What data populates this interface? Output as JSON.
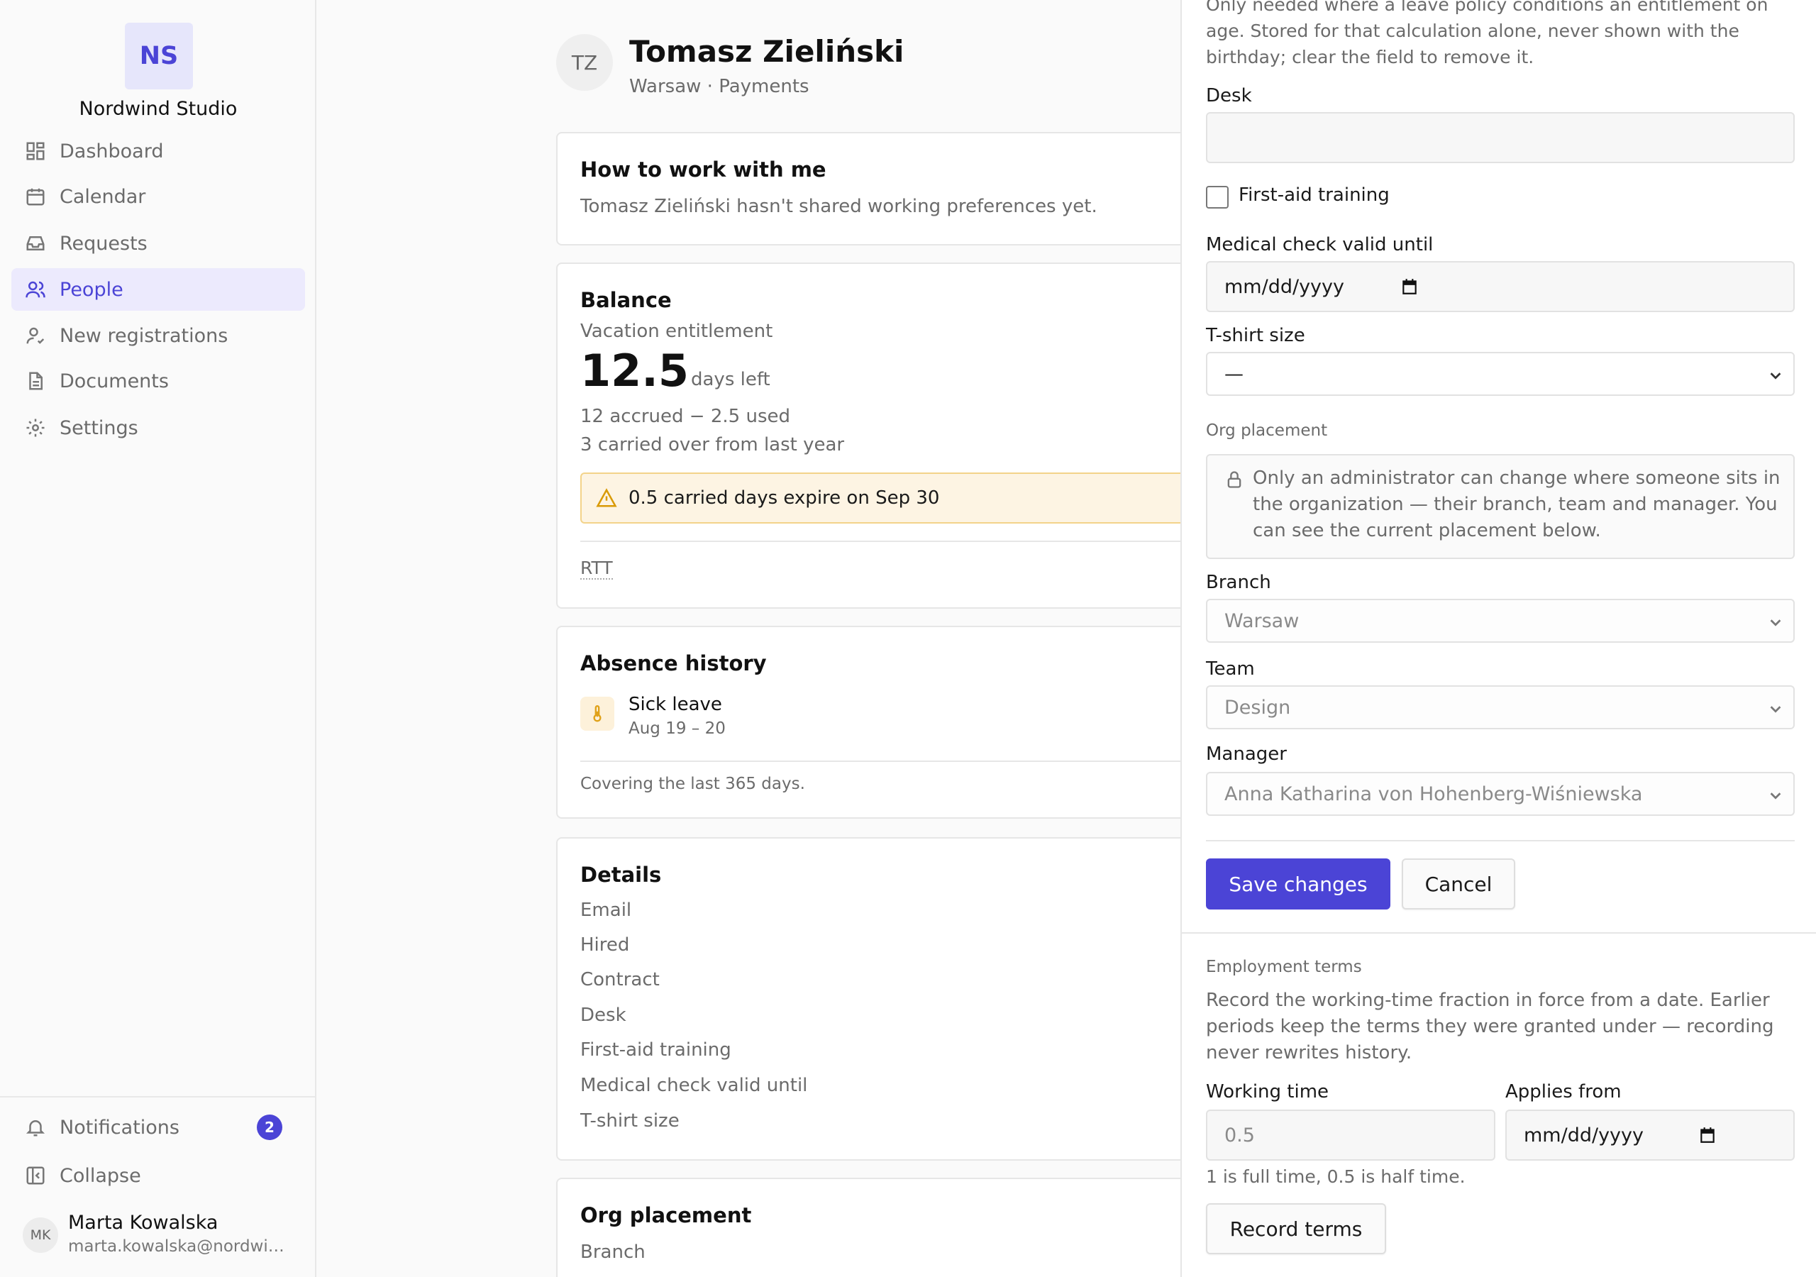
{
  "sidebar": {
    "brand_initials": "NS",
    "brand_name": "Nordwind Studio",
    "nav": [
      {
        "label": "Dashboard",
        "icon": "dashboard-icon"
      },
      {
        "label": "Calendar",
        "icon": "calendar-icon"
      },
      {
        "label": "Requests",
        "icon": "inbox-icon"
      },
      {
        "label": "People",
        "icon": "people-icon",
        "active": true
      },
      {
        "label": "New registrations",
        "icon": "user-check-icon"
      },
      {
        "label": "Documents",
        "icon": "document-icon"
      },
      {
        "label": "Settings",
        "icon": "gear-icon"
      }
    ],
    "notifications_label": "Notifications",
    "notifications_count": "2",
    "collapse_label": "Collapse",
    "user": {
      "initials": "MK",
      "name": "Marta Kowalska",
      "email": "marta.kowalska@nordwind.studio"
    }
  },
  "profile": {
    "initials": "TZ",
    "name": "Tomasz Zieliński",
    "subtitle": "Warsaw · Payments"
  },
  "work_card": {
    "title": "How to work with me",
    "text": "Tomasz Zieliński hasn't shared working preferences yet."
  },
  "balance": {
    "title": "Balance",
    "subtitle": "Vacation entitlement",
    "value": "12.5",
    "unit": "days left",
    "accrued_line": "12 accrued − 2.5 used",
    "carried_line": "3 carried over from last year",
    "warning": "0.5 carried days expire on Sep 30",
    "rtt_label": "RTT"
  },
  "absence": {
    "title": "Absence history",
    "item_title": "Sick leave",
    "item_dates": "Aug 19 – 20",
    "footer": "Covering the last 365 days."
  },
  "details": {
    "title": "Details",
    "rows": [
      "Email",
      "Hired",
      "Contract",
      "Desk",
      "First-aid training",
      "Medical check valid until",
      "T-shirt size"
    ]
  },
  "org_card": {
    "title": "Org placement",
    "first_row": "Branch"
  },
  "drawer": {
    "top_help": "Only needed where a leave policy conditions an entitlement on age. Stored for that calculation alone, never shown with the birthday; clear the field to remove it.",
    "desk_label": "Desk",
    "desk_value": "",
    "first_aid_label": "First-aid training",
    "medical_label": "Medical check valid until",
    "medical_placeholder": "mm/dd/yyyy",
    "tshirt_label": "T-shirt size",
    "tshirt_value": "—",
    "org_section": "Org placement",
    "org_notice": "Only an administrator can change where someone sits in the organization — their branch, team and manager. You can see the current placement below.",
    "branch_label": "Branch",
    "branch_value": "Warsaw",
    "team_label": "Team",
    "team_value": "Design",
    "manager_label": "Manager",
    "manager_value": "Anna Katharina von Hohenberg-Wiśniewska",
    "save_label": "Save changes",
    "cancel_label": "Cancel",
    "terms_section": "Employment terms",
    "terms_help": "Record the working-time fraction in force from a date. Earlier periods keep the terms they were granted under — recording never rewrites history.",
    "working_time_label": "Working time",
    "working_time_placeholder": "0.5",
    "applies_from_label": "Applies from",
    "applies_from_placeholder": "mm/dd/yyyy",
    "fraction_hint": "1 is full time, 0.5 is half time.",
    "record_label": "Record terms"
  },
  "colors": {
    "accent": "#4b44d6",
    "accent_soft": "#eceafd",
    "warning_bg": "#fdf4e3",
    "warning_icon": "#d99a06"
  }
}
